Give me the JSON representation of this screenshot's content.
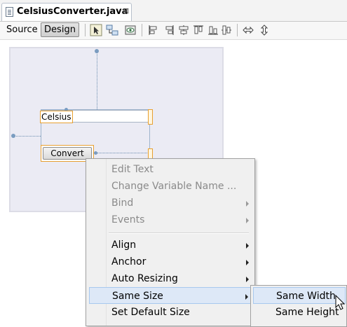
{
  "tab": {
    "title": "CelsiusConverter.java",
    "close_glyph": "⊠"
  },
  "toolbar": {
    "source_label": "Source",
    "design_label": "Design",
    "icons": [
      "selection-mode-icon",
      "connection-mode-icon",
      "preview-design-icon",
      "align-left-icon",
      "align-right-icon",
      "center-horizontally-icon",
      "align-top-icon",
      "align-bottom-icon",
      "center-vertically-icon",
      "change-horizontal-resizability-icon",
      "change-vertical-resizability-icon"
    ]
  },
  "canvas": {
    "celsius_label": "Celsius",
    "convert_button": "Convert"
  },
  "menu": {
    "items": [
      {
        "label": "Edit Text",
        "enabled": false,
        "submenu": false
      },
      {
        "label": "Change Variable Name ...",
        "enabled": false,
        "submenu": false
      },
      {
        "label": "Bind",
        "enabled": false,
        "submenu": true
      },
      {
        "label": "Events",
        "enabled": false,
        "submenu": true
      },
      {
        "label": "Align",
        "enabled": true,
        "submenu": true
      },
      {
        "label": "Anchor",
        "enabled": true,
        "submenu": true
      },
      {
        "label": "Auto Resizing",
        "enabled": true,
        "submenu": true
      },
      {
        "label": "Same Size",
        "enabled": true,
        "submenu": true,
        "highlighted": true
      },
      {
        "label": "Set Default Size",
        "enabled": true,
        "submenu": false
      }
    ]
  },
  "submenu": {
    "items": [
      {
        "label": "Same Width",
        "highlighted": true
      },
      {
        "label": "Same Height",
        "highlighted": false
      }
    ]
  },
  "colors": {
    "highlight": "#dde8f7",
    "selection_orange": "#e8a030",
    "canvas_bg": "#ebebf4"
  }
}
